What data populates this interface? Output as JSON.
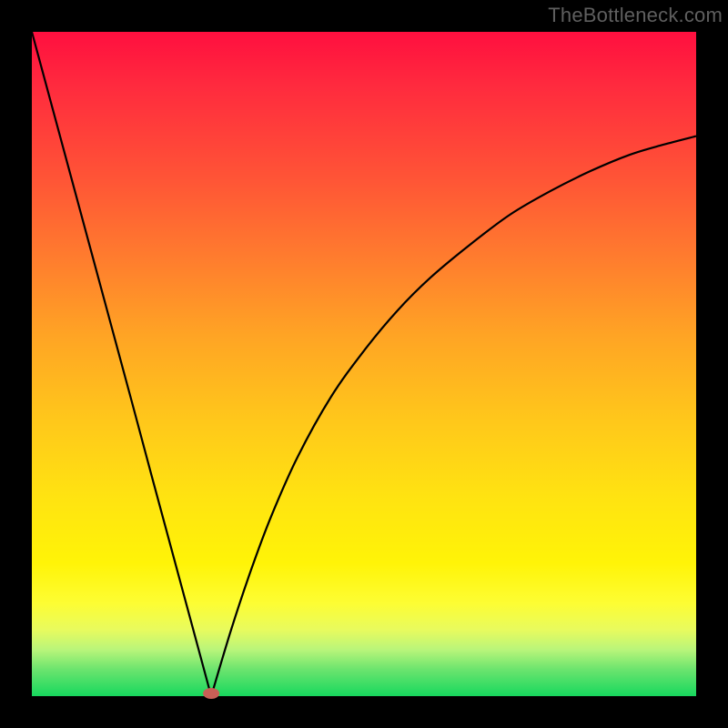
{
  "watermark": "TheBottleneck.com",
  "chart_data": {
    "type": "line",
    "title": "",
    "xlabel": "",
    "ylabel": "",
    "xlim": [
      0,
      100
    ],
    "ylim": [
      0,
      100
    ],
    "grid": false,
    "legend": false,
    "min_x_percent": 27,
    "marker": {
      "x_percent": 27,
      "y_percent": 0
    },
    "series": [
      {
        "name": "bottleneck_curve",
        "x_percent": [
          0,
          3,
          6,
          9,
          12,
          15,
          18,
          21,
          24,
          27,
          30,
          33,
          36,
          40,
          45,
          50,
          55,
          60,
          66,
          72,
          78,
          84,
          90,
          95,
          100
        ],
        "y_percent": [
          100,
          88.9,
          77.8,
          66.7,
          55.6,
          44.5,
          33.3,
          22.2,
          11.1,
          0,
          10,
          19,
          27,
          36,
          45,
          52,
          58,
          63,
          68,
          72.5,
          76,
          79,
          81.5,
          83,
          84.3
        ]
      }
    ],
    "background_gradient": {
      "direction": "vertical",
      "stops": [
        {
          "pos": 0.0,
          "color": "#ff0f3f"
        },
        {
          "pos": 0.22,
          "color": "#ff5436"
        },
        {
          "pos": 0.46,
          "color": "#ffa524"
        },
        {
          "pos": 0.7,
          "color": "#ffe311"
        },
        {
          "pos": 0.86,
          "color": "#fdfd33"
        },
        {
          "pos": 0.96,
          "color": "#6be46e"
        },
        {
          "pos": 1.0,
          "color": "#17d85e"
        }
      ]
    }
  }
}
